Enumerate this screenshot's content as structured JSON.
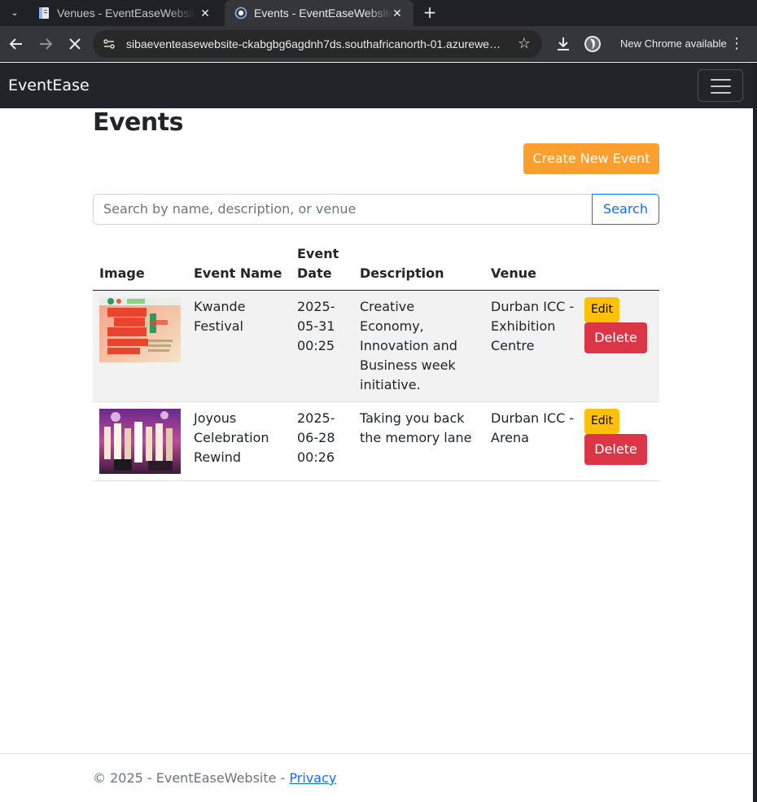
{
  "browser": {
    "tabs": [
      {
        "title": "Venues - EventEaseWebsite",
        "active": false,
        "icon": "document-icon"
      },
      {
        "title": "Events - EventEaseWebsite",
        "active": true,
        "icon": "loading-globe-icon"
      }
    ],
    "close_glyph": "✕",
    "new_tab_glyph": "+",
    "tab_menu_glyph": "⌄",
    "url": "sibaeventeasewebsite-ckabgbg6agdnh7ds.southafricanorth-01.azurewe…",
    "update_label": "New Chrome available",
    "colors": {
      "frame": "#202124",
      "toolbar": "#35363a",
      "omnibox": "#282828"
    }
  },
  "site": {
    "brand": "EventEase",
    "colors": {
      "navbar": "#212529",
      "primary": "#0d6efd",
      "warning": "#ffc107",
      "danger": "#dc3545",
      "create": "#fd9f2e"
    }
  },
  "page": {
    "title": "Events",
    "create_label": "Create New Event",
    "search": {
      "placeholder": "Search by name, description, or venue",
      "button_label": "Search"
    }
  },
  "table": {
    "headers": [
      "Image",
      "Event Name",
      "Event Date",
      "Description",
      "Venue"
    ],
    "rows": [
      {
        "image_alt": "Save the date poster 14-15 March 2025",
        "name": "Kwande Festival",
        "date": "2025-05-31 00:25",
        "description": "Creative Economy, Innovation and Business week initiative.",
        "venue": "Durban ICC - Exhibition Centre",
        "edit_label": "Edit",
        "delete_label": "Delete"
      },
      {
        "image_alt": "Choir performing on stage",
        "name": "Joyous Celebration Rewind",
        "date": "2025-06-28 00:26",
        "description": "Taking you back the memory lane",
        "venue": "Durban ICC - Arena",
        "edit_label": "Edit",
        "delete_label": "Delete"
      }
    ]
  },
  "footer": {
    "text": "© 2025 - EventEaseWebsite - ",
    "privacy_label": "Privacy"
  }
}
